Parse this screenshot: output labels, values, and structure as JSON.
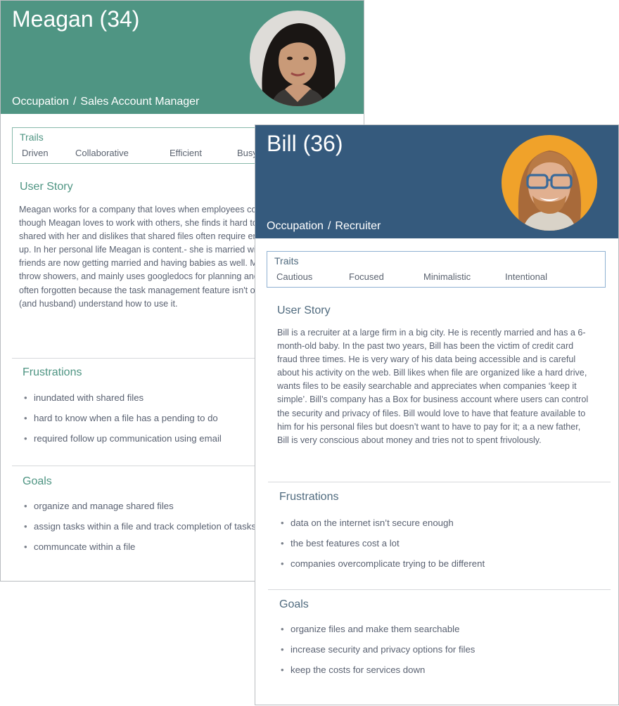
{
  "personas": [
    {
      "name": "Meagan (34)",
      "occupation_label": "Occupation",
      "occupation_sep": "/",
      "occupation": "Sales Account Manager",
      "traits_title": "Trails",
      "traits": [
        "Driven",
        "Collaborative",
        "Efficient",
        "Busy"
      ],
      "user_story_title": "User Story",
      "user_story": "Meagan works for a company that loves when employees collaborate on projects, and though Meagan loves to work with others, she finds it hard to manage all of the files that get shared with her and dislikes that shared files often require emails for clarification and follow up. In her personal life Meagan is content.- she is married with two kids and many of her friends are now getting married and having babies as well. Meagan loves to help plan and throw showers, and mainly uses googledocs for planning and assigning tasks, but tasks are often forgotten because the task management feature isn't obvious and few of her freinds (and husband) understand how to use it.",
      "frustrations_title": "Frustrations",
      "frustrations": [
        "inundated with shared files",
        "hard to know when a file has a pending to do",
        "required follow up communication using email"
      ],
      "goals_title": "Goals",
      "goals": [
        "organize and manage shared files",
        "assign tasks within a file and track completion of tasks",
        "communcate within a file"
      ],
      "colors": {
        "header": "#4f9583"
      }
    },
    {
      "name": "Bill (36)",
      "occupation_label": "Occupation",
      "occupation_sep": "/",
      "occupation": "Recruiter",
      "traits_title": "Traits",
      "traits": [
        "Cautious",
        "Focused",
        "Minimalistic",
        "Intentional"
      ],
      "user_story_title": "User Story",
      "user_story": "Bill is a recruiter at a large firm in a big city. He is recently married and has a 6-month-old baby. In the past two years, Bill has been the victim of credit card fraud three times. He is very wary of his data being accessible and is careful about his activity on the web. Bill likes when file are organized like a hard drive, wants files to be easily searchable and appreciates when companies ‘keep it simple’. Bill’s company has a Box for business account where users can control the security and privacy of files. Bill would love to have that feature available to him for his personal files but doesn’t want to have to pay for it; a a new father, Bill is very conscious about money and tries not to spent frivolously.",
      "frustrations_title": "Frustrations",
      "frustrations": [
        "data on the internet isn’t secure enough",
        "the best features cost a lot",
        "companies overcomplicate trying to be different"
      ],
      "goals_title": "Goals",
      "goals": [
        "organize files and make them searchable",
        "increase security and privacy options for files",
        "keep the costs for services down"
      ],
      "colors": {
        "header": "#355a7d"
      }
    }
  ]
}
